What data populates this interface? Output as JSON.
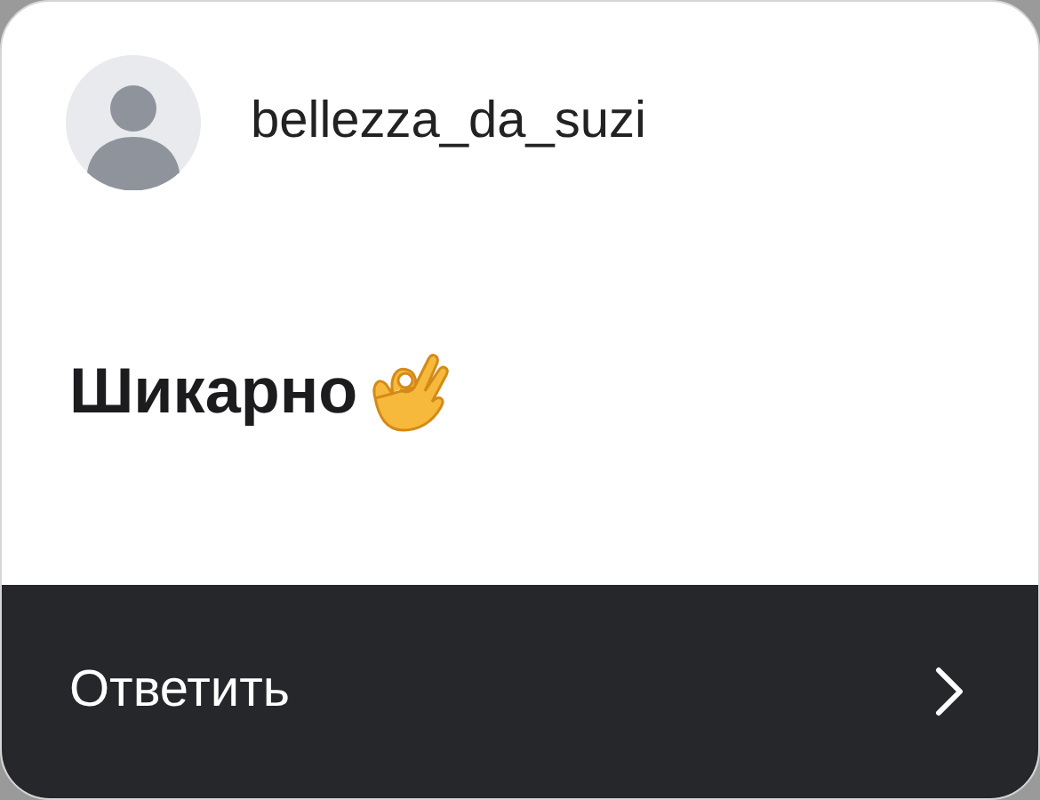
{
  "comment": {
    "username": "bellezza_da_suzi",
    "text": "Шикарно"
  },
  "reply_bar": {
    "label": "Ответить"
  }
}
